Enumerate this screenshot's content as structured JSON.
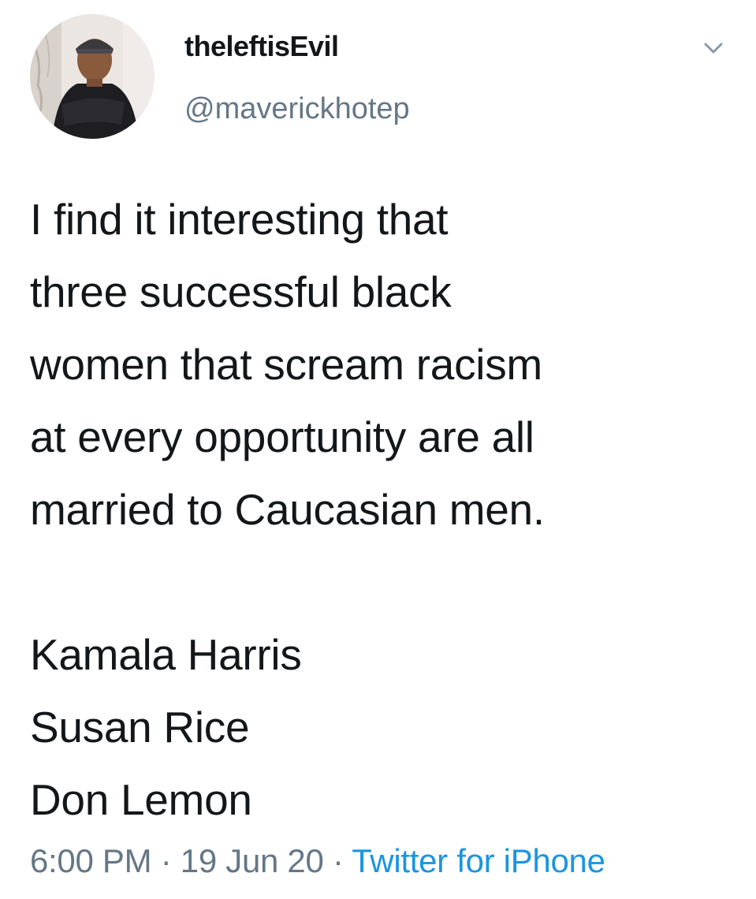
{
  "tweet": {
    "display_name": "theleftisEvil",
    "handle": "@maverickhotep",
    "body_lines": [
      "I find it interesting that",
      "three successful black",
      "women that scream racism",
      "at every opportunity are all",
      "married to Caucasian men.",
      "",
      "Kamala Harris",
      "Susan Rice",
      "Don Lemon"
    ],
    "time": "6:00 PM",
    "separator": "·",
    "date": "19 Jun 20",
    "source": "Twitter for iPhone"
  },
  "icons": {
    "menu": "chevron-down-icon"
  },
  "colors": {
    "text": "#14171a",
    "muted": "#657786",
    "link": "#1b95e0",
    "background": "#ffffff"
  }
}
